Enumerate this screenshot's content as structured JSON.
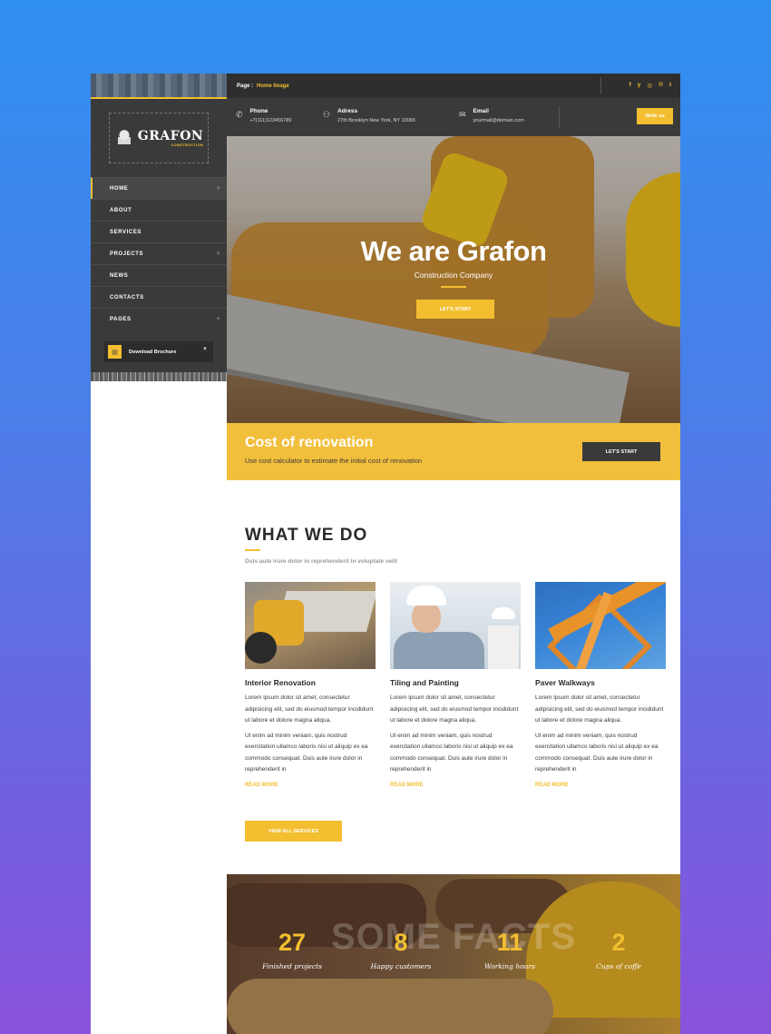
{
  "breadcrumb": {
    "label": "Page :",
    "value": "Home Image"
  },
  "socials": [
    {
      "icon": "facebook-icon",
      "glyph": "f"
    },
    {
      "icon": "twitter-icon",
      "glyph": "y"
    },
    {
      "icon": "instagram-icon",
      "glyph": "◎"
    },
    {
      "icon": "pinterest-icon",
      "glyph": "℗"
    },
    {
      "icon": "tumblr-icon",
      "glyph": "t"
    }
  ],
  "contact": {
    "phone": {
      "title": "Phone",
      "value": "+7(111)123456789"
    },
    "address": {
      "title": "Adress",
      "value": "27th Brooklyn New York, NY 10065"
    },
    "email": {
      "title": "Email",
      "value": "yourmail@domain.com"
    },
    "write_button": "Write us"
  },
  "logo": {
    "name": "GRAFON",
    "tagline": "CONSTRUCTION"
  },
  "nav": [
    {
      "label": "HOME",
      "plus": "+"
    },
    {
      "label": "ABOUT",
      "plus": ""
    },
    {
      "label": "SERVICES",
      "plus": ""
    },
    {
      "label": "PROJECTS",
      "plus": "+"
    },
    {
      "label": "NEWS",
      "plus": ""
    },
    {
      "label": "CONTACTS",
      "plus": ""
    },
    {
      "label": "PAGES",
      "plus": "+"
    }
  ],
  "brochure": {
    "label": "Download Brochure"
  },
  "hero": {
    "title": "We are Grafon",
    "subtitle": "Construction Company",
    "button": "LET'S START"
  },
  "cost": {
    "title": "Cost of renovation",
    "description": "Use cost calculator to estimate the initial cost of renovation",
    "button": "LET'S START"
  },
  "what_we_do": {
    "title": "WHAT WE DO",
    "subtitle": "Duis aute irure dolor in reprehenderit in voluptate velit",
    "cards": [
      {
        "title": "Interior Renovation",
        "text1": "Lorem ipsum dolor sit amet, consectetur adipisicing elit, sed do eiusmod tempor incididunt ut labore et dolore magna aliqua.",
        "text2": "Ut enim ad minim veniam, quis nostrud exercitation ullamco laboris nisi ut aliquip ex ea commodo consequat. Duis aute irure dolor in reprehenderit in",
        "link": "READ MORE"
      },
      {
        "title": "Tiling and Painting",
        "text1": "Lorem ipsum dolor sit amet, consectetur adipisicing elit, sed do eiusmod tempor incididunt ut labore et dolore magna aliqua.",
        "text2": "Ut enim ad minim veniam, quis nostrud exercitation ullamco laboris nisi ut aliquip ex ea commodo consequat. Duis aute irure dolor in reprehenderit in",
        "link": "READ MORE"
      },
      {
        "title": "Paver Walkways",
        "text1": "Lorem ipsum dolor sit amet, consectetur adipisicing elit, sed do eiusmod tempor incididunt ut labore et dolore magna aliqua.",
        "text2": "Ut enim ad minim veniam, quis nostrud exercitation ullamco laboris nisi ut aliquip ex ea commodo consequat. Duis aute irure dolor in reprehenderit in",
        "link": "READ MORE"
      }
    ],
    "view_all": "VIEW ALL SERVICES"
  },
  "facts": {
    "title": "SOME FACTS",
    "items": [
      {
        "number": "27",
        "label": "Finished projects"
      },
      {
        "number": "8",
        "label": "Happy customers"
      },
      {
        "number": "11",
        "label": "Working hours"
      },
      {
        "number": "2",
        "label": "Cups of coffe"
      }
    ]
  },
  "colors": {
    "accent": "#f3be2f",
    "dark": "#3a3a3a",
    "topbar": "#2e2e2e",
    "background_gradient": [
      "#2f8ff0",
      "#8a53dc"
    ]
  }
}
